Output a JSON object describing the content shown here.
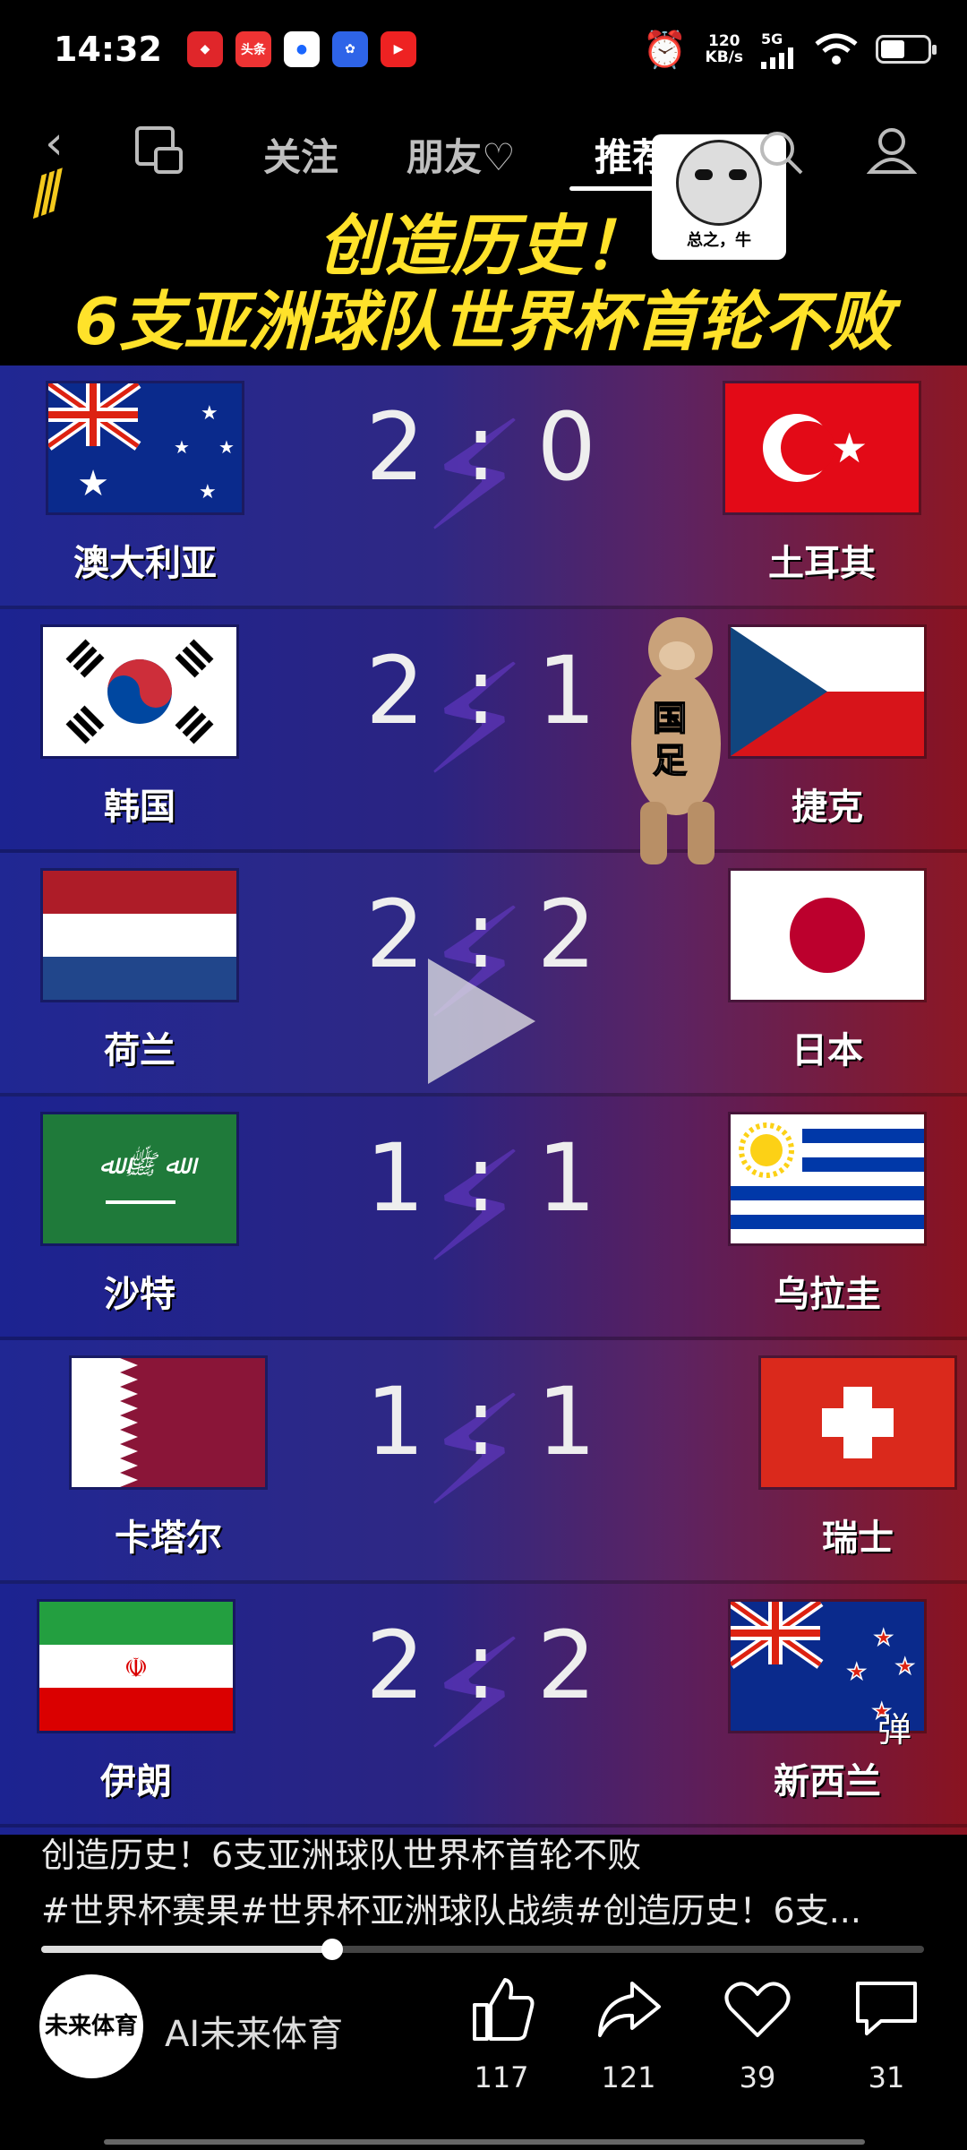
{
  "status_bar": {
    "time": "14:32",
    "net_speed": "120",
    "net_unit": "KB/s",
    "signal_label": "5G",
    "notification_icons": [
      "pinduoduo-icon",
      "toutiao-icon",
      "browser-icon",
      "baidu-icon",
      "video-app-icon"
    ],
    "toutiao_text": "头条"
  },
  "top_nav": {
    "tabs": [
      "关注",
      "朋友♡",
      "推荐"
    ],
    "active_tab": "推荐"
  },
  "video": {
    "headline_line1": "创造历史！",
    "headline_line2": "6支亚洲球队世界杯首轮不败",
    "meme_caption": "总之，牛",
    "monkey_sticker_text": "国\n足",
    "danmu_label": "弹",
    "matches": [
      {
        "home": "澳大利亚",
        "home_flag": "australia",
        "score": "2 : 0",
        "away": "土耳其",
        "away_flag": "turkey"
      },
      {
        "home": "韩国",
        "home_flag": "korea",
        "score": "2 : 1",
        "away": "捷克",
        "away_flag": "czech"
      },
      {
        "home": "荷兰",
        "home_flag": "netherlands",
        "score": "2 : 2",
        "away": "日本",
        "away_flag": "japan"
      },
      {
        "home": "沙特",
        "home_flag": "saudi",
        "score": "1 : 1",
        "away": "乌拉圭",
        "away_flag": "uruguay"
      },
      {
        "home": "卡塔尔",
        "home_flag": "qatar",
        "score": "1 : 1",
        "away": "瑞士",
        "away_flag": "switzerland"
      },
      {
        "home": "伊朗",
        "home_flag": "iran",
        "score": "2 : 2",
        "away": "新西兰",
        "away_flag": "newzealand"
      }
    ]
  },
  "caption": {
    "title": "创造历史！6支亚洲球队世界杯首轮不败",
    "tags": "#世界杯赛果#世界杯亚洲球队战绩#创造历史！6支..."
  },
  "progress": {
    "fraction": 0.33
  },
  "author": {
    "avatar_text": "未来体育",
    "name": "AI未来体育"
  },
  "actions": {
    "like_count": "117",
    "share_count": "121",
    "favorite_count": "39",
    "comment_count": "31"
  },
  "colors": {
    "headline": "#ffe22a",
    "board_left": "#1c2391",
    "board_right": "#8a1320"
  }
}
